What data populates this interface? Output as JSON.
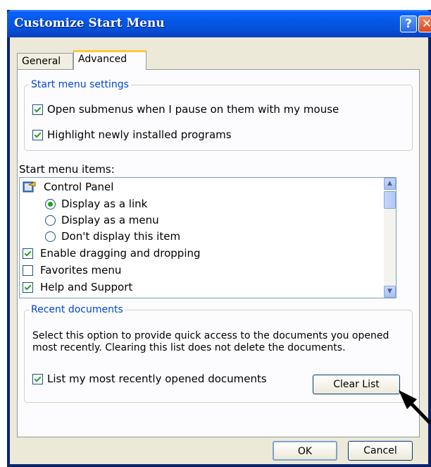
{
  "window": {
    "title": "Customize Start Menu",
    "help_glyph": "?",
    "close_glyph": "✕"
  },
  "tabs": [
    {
      "label": "General"
    },
    {
      "label": "Advanced"
    }
  ],
  "start_menu_settings": {
    "legend": "Start menu settings",
    "options": [
      {
        "label": "Open submenus when I pause on them with my mouse",
        "checked": true
      },
      {
        "label": "Highlight newly installed programs",
        "checked": true
      }
    ]
  },
  "start_menu_items": {
    "label": "Start menu items:",
    "control_panel": "Control Panel",
    "radio_options": [
      {
        "label": "Display as a link",
        "selected": true
      },
      {
        "label": "Display as a menu",
        "selected": false
      },
      {
        "label": "Don't display this item",
        "selected": false
      }
    ],
    "checkbox_items": [
      {
        "label": "Enable dragging and dropping",
        "checked": true
      },
      {
        "label": "Favorites menu",
        "checked": false
      },
      {
        "label": "Help and Support",
        "checked": true
      }
    ]
  },
  "recent_documents": {
    "legend": "Recent documents",
    "description": "Select this option to provide quick access to the documents you opened most recently.  Clearing this list does not delete the documents.",
    "checkbox_label": "List my most recently opened documents",
    "checked": true,
    "clear_button": "Clear List"
  },
  "footer": {
    "ok_label": "OK",
    "cancel_label": "Cancel"
  },
  "colors": {
    "title_bar": "#0458e6",
    "dialog_face": "#ece9d8",
    "group_legend": "#0046d5",
    "check_mark": "#21a121"
  }
}
